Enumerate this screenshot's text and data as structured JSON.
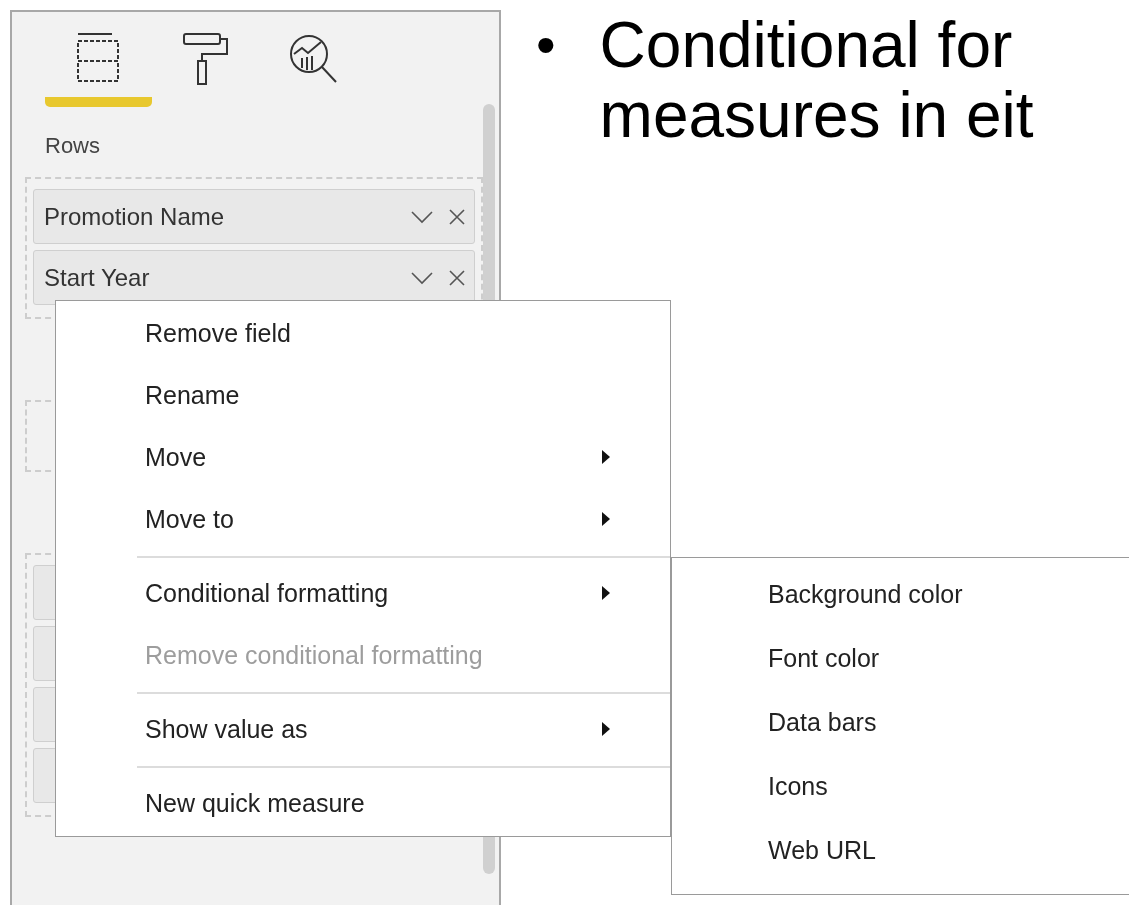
{
  "panel": {
    "tabs": [
      {
        "kind": "fields",
        "selected": true
      },
      {
        "kind": "format",
        "selected": false
      },
      {
        "kind": "analytics",
        "selected": false
      }
    ],
    "sections": [
      {
        "kind": "labeled",
        "label": "Rows",
        "fields": [
          {
            "kind": "full",
            "name": "Promotion Name"
          },
          {
            "kind": "full",
            "name": "Start Year"
          }
        ]
      },
      {
        "kind": "covered"
      },
      {
        "kind": "covered",
        "fields": [
          {
            "kind": "covered"
          },
          {
            "kind": "covered"
          },
          {
            "kind": "covered"
          },
          {
            "kind": "covered"
          }
        ]
      }
    ]
  },
  "context_menu": {
    "items": [
      {
        "kind": "item",
        "label": "Remove field",
        "disabled": false,
        "has_submenu": false
      },
      {
        "kind": "item",
        "label": "Rename",
        "disabled": false,
        "has_submenu": false
      },
      {
        "kind": "item",
        "label": "Move",
        "disabled": false,
        "has_submenu": true
      },
      {
        "kind": "item",
        "label": "Move to",
        "disabled": false,
        "has_submenu": true
      },
      {
        "kind": "separator"
      },
      {
        "kind": "item",
        "label": "Conditional formatting",
        "disabled": false,
        "has_submenu": true,
        "expanded": true,
        "submenu": [
          "Background color",
          "Font color",
          "Data bars",
          "Icons",
          "Web URL"
        ]
      },
      {
        "kind": "item",
        "label": "Remove conditional formatting",
        "disabled": true,
        "has_submenu": false
      },
      {
        "kind": "separator"
      },
      {
        "kind": "item",
        "label": "Show value as",
        "disabled": false,
        "has_submenu": true
      },
      {
        "kind": "separator"
      },
      {
        "kind": "item",
        "label": "New quick measure",
        "disabled": false,
        "has_submenu": false
      }
    ]
  },
  "slide": {
    "bullet": "•",
    "lines": [
      "Conditional for",
      "measures in eit"
    ]
  }
}
